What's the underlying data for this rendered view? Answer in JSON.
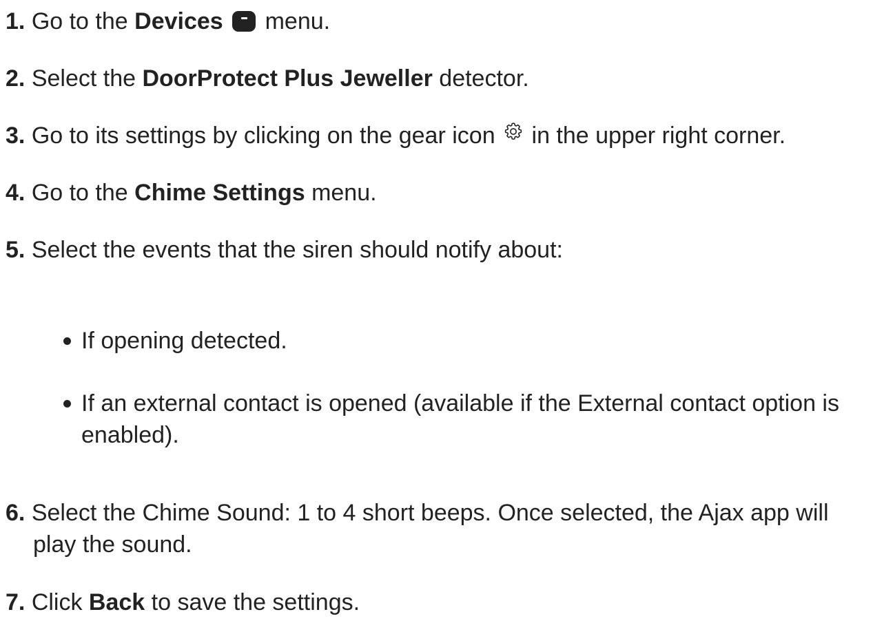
{
  "steps": [
    {
      "num": "1.",
      "pre": "Go to the ",
      "bold": "Devices",
      "post": " menu."
    },
    {
      "num": "2.",
      "pre": "Select the ",
      "bold": "DoorProtect Plus Jeweller",
      "post": " detector."
    },
    {
      "num": "3.",
      "pre": "Go to its settings by clicking on the gear icon ",
      "post": " in the upper right corner."
    },
    {
      "num": "4.",
      "pre": "Go to the ",
      "bold": "Chime Settings",
      "post": " menu."
    },
    {
      "num": "5.",
      "pre": "Select the events that the siren should notify about:"
    },
    {
      "num": "6.",
      "pre": "Select the Chime Sound: 1 to 4 short beeps. Once selected, the Ajax app will",
      "line2": "play the sound."
    },
    {
      "num": "7.",
      "pre": "Click ",
      "bold": "Back",
      "post": " to save the settings."
    }
  ],
  "bullets": [
    {
      "line1": "If opening detected."
    },
    {
      "line1": "If an external contact is opened (available if the External contact option is",
      "line2": "enabled)."
    }
  ],
  "icons": {
    "devices": "devices-icon",
    "gear": "gear-icon"
  }
}
